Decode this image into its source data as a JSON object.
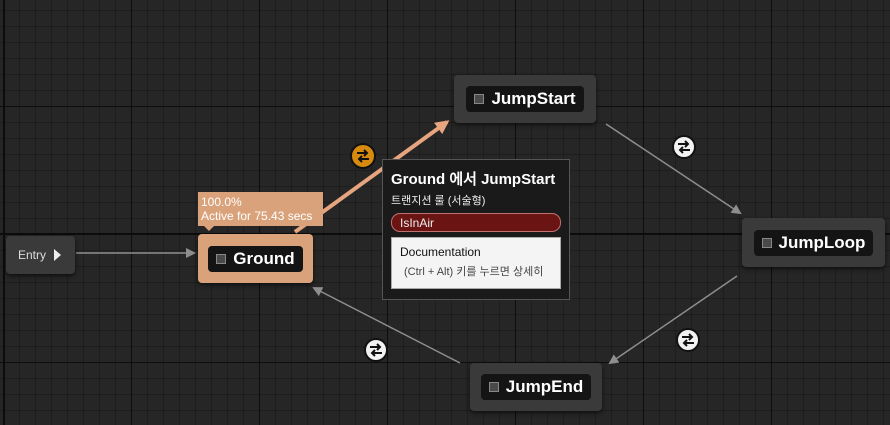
{
  "graph": {
    "entry_label": "Entry",
    "states": {
      "ground": "Ground",
      "jump_start": "JumpStart",
      "jump_loop": "JumpLoop",
      "jump_end": "JumpEnd"
    },
    "active_badge": {
      "percent": "100.0%",
      "duration": "Active for 75.43 secs"
    },
    "colors": {
      "active_state": "#d9a27a",
      "active_transition": "#d78a0e",
      "rule_fill": "#6b1414"
    }
  },
  "tooltip": {
    "title": "Ground 에서 JumpStart",
    "subtitle": "트랜지션 룰 (서술형)",
    "rule_value": "IsInAir",
    "doc_title": "Documentation",
    "doc_hint": "(Ctrl + Alt) 키를 누르면 상세히"
  }
}
